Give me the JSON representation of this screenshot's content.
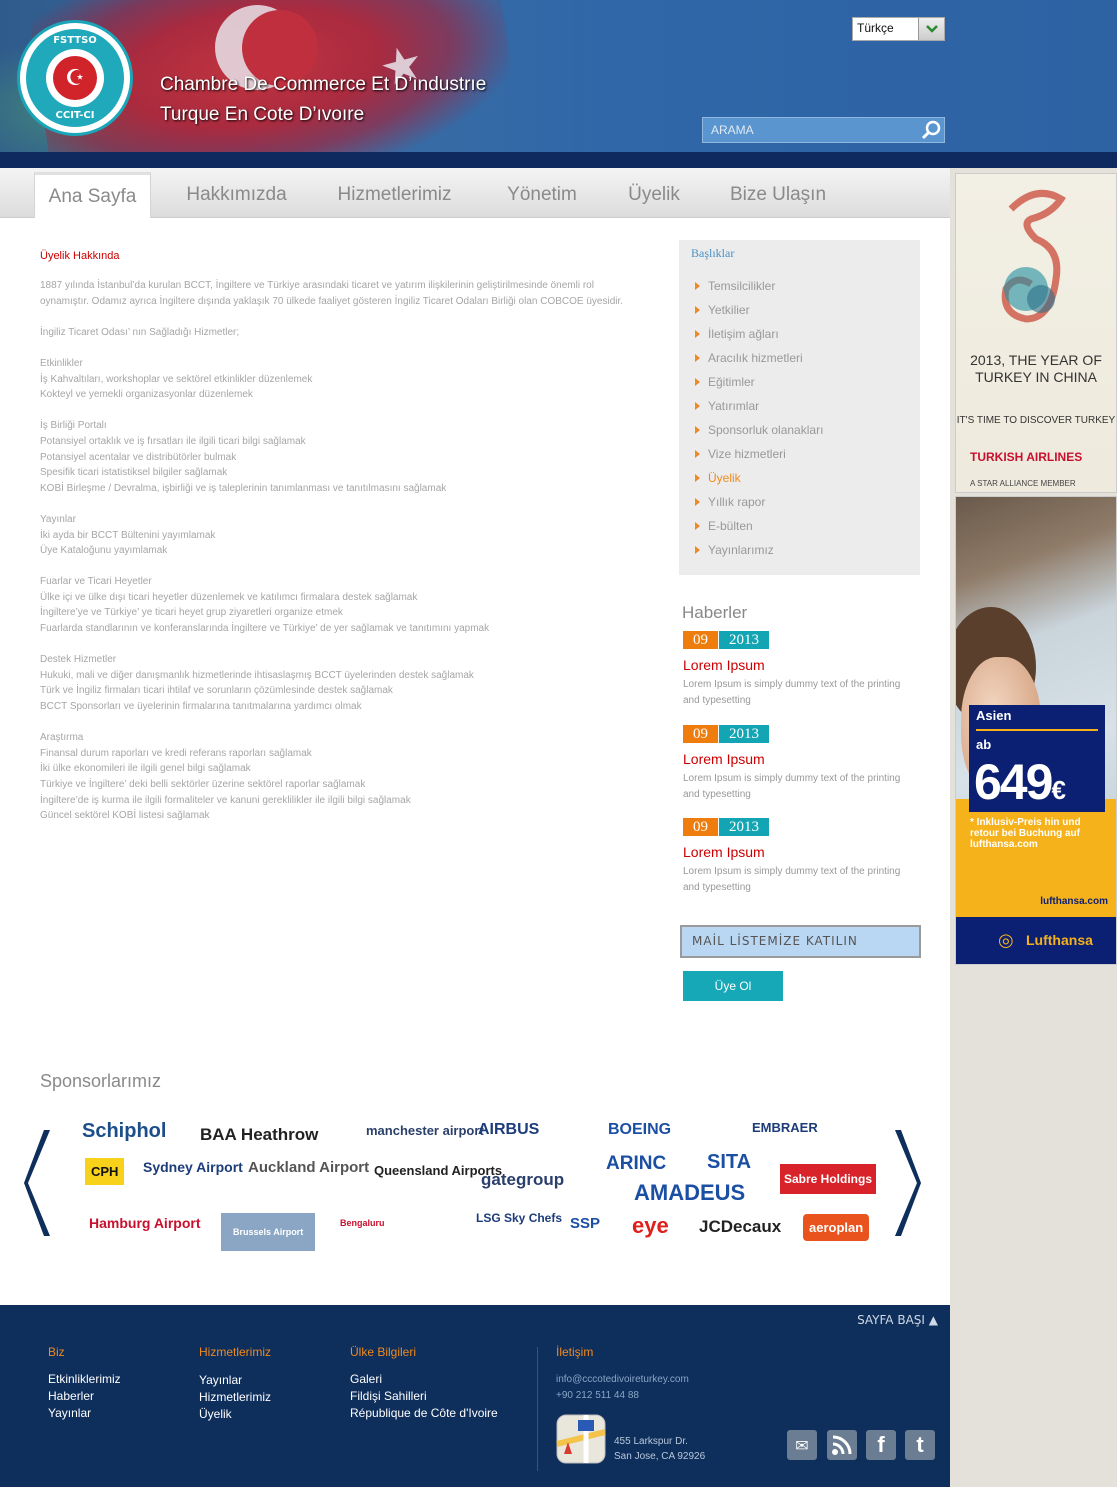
{
  "header": {
    "logo_top": "FSTTSO",
    "logo_bottom": "CCIT-CI",
    "title_line1": "Chambre De Commerce  Et D’ındustrıe",
    "title_line2": "Turque En Cote D’ıvoıre",
    "language": "Türkçe",
    "search_placeholder": "ARAMA"
  },
  "nav": {
    "items": [
      "Ana Sayfa",
      "Hakkımızda",
      "Hizmetlerimiz",
      "Yönetim",
      "Üyelik",
      "Bize Ulaşın"
    ],
    "active": "Ana Sayfa"
  },
  "content": {
    "title": "Üyelik Hakkında",
    "intro": "1887 yılında İstanbul’da kurulan BCCT, İngiltere ve Türkiye arasındaki ticaret ve yatırım ilişkilerinin geliştirilmesinde önemli rol oynamıştır. Odamız ayrıca İngiltere dışında yaklaşık 70 ülkede faaliyet gösteren İngiliz Ticaret Odaları Birliği olan COBCOE üyesidir.",
    "services_heading": "İngiliz Ticaret Odası’ nın Sağladığı Hizmetler;",
    "sections": [
      {
        "title": "Etkinlikler",
        "lines": [
          "İş Kahvaltıları, workshoplar ve sektörel etkinlikler düzenlemek",
          "Kokteyl ve yemekli organizasyonlar düzenlemek"
        ]
      },
      {
        "title": "İş Birliği Portalı",
        "lines": [
          "Potansiyel ortaklık ve iş fırsatları ile ilgili ticari bilgi sağlamak",
          "Potansiyel acentalar ve distribütörler bulmak",
          "Spesifik ticari istatistiksel bilgiler sağlamak",
          "KOBİ Birleşme / Devralma, işbirliği ve iş taleplerinin tanımlanması ve tanıtılmasını sağlamak"
        ]
      },
      {
        "title": "Yayınlar",
        "lines": [
          "İki ayda bir BCCT Bültenini yayımlamak",
          "Üye Kataloğunu yayımlamak"
        ]
      },
      {
        "title": "Fuarlar ve Ticari Heyetler",
        "lines": [
          "Ülke içi ve ülke dışı ticari heyetler düzenlemek ve katılımcı firmalara destek sağlamak",
          "İngiltere’ye ve Türkiye’ ye ticari heyet grup ziyaretleri organize etmek",
          "Fuarlarda standlarının ve konferanslarında İngiltere ve Türkiye’ de yer sağlamak ve tanıtımını yapmak"
        ]
      },
      {
        "title": "Destek Hizmetler",
        "lines": [
          "Hukuki, mali ve diğer danışmanlık hizmetlerinde ihtisaslaşmış BCCT üyelerinden destek sağlamak",
          "Türk ve İngiliz firmaları ticari ihtilaf ve sorunların çözümlesinde destek sağlamak",
          "BCCT Sponsorları ve üyelerinin firmalarına tanıtmalarına yardımcı olmak"
        ]
      },
      {
        "title": "Araştırma",
        "lines": [
          "Finansal durum raporları ve kredi referans raporları sağlamak",
          "İki ülke ekonomileri ile ilgili genel bilgi sağlamak",
          "Türkiye ve İngiltere’ deki belli sektörler üzerine sektörel raporlar sağlamak",
          "İngiltere’de iş kurma ile ilgili formaliteler ve kanuni gereklilikler ile ilgili bilgi sağlamak",
          "Güncel sektörel KOBİ listesi sağlamak"
        ]
      }
    ]
  },
  "sidebar": {
    "heading": "Başlıklar",
    "items": [
      "Temsilcilikler",
      "Yetkilier",
      "İletişim ağları",
      "Aracılık hizmetleri",
      "Eğitimler",
      "Yatırımlar",
      "Sponsorluk olanakları",
      "Vize hizmetleri",
      "Üyelik",
      "Yıllık rapor",
      "E-bülten",
      "Yayınlarımız"
    ],
    "active": "Üyelik"
  },
  "news": {
    "heading": "Haberler",
    "items": [
      {
        "day": "09",
        "year": "2013",
        "title": "Lorem Ipsum",
        "text": "Lorem Ipsum is simply dummy text of the printing and typesetting"
      },
      {
        "day": "09",
        "year": "2013",
        "title": "Lorem Ipsum",
        "text": "Lorem Ipsum is simply dummy text of the printing and typesetting"
      },
      {
        "day": "09",
        "year": "2013",
        "title": "Lorem Ipsum",
        "text": "Lorem Ipsum is simply dummy text of the printing and typesetting"
      }
    ]
  },
  "mailing": {
    "label": "MAİL LİSTEMİZE KATILIN",
    "button": "Üye Ol"
  },
  "sponsors": {
    "heading": "Sponsorlarımız",
    "logos": [
      "Schiphol",
      "BAA Heathrow",
      "manchester airport",
      "AIRBUS",
      "BOEING",
      "EMBRAER",
      "CPH",
      "Sydney Airport",
      "Auckland Airport",
      "Queensland Airports",
      "gategroup",
      "ARINC",
      "SITA",
      "Sabre Holdings",
      "AMADEUS",
      "Hamburg Airport",
      "Brussels Airport",
      "Bengaluru",
      "LSG Sky Chefs",
      "SSP",
      "eye",
      "JCDecaux",
      "aeroplan"
    ]
  },
  "ads": {
    "thy": {
      "line1": "2013, THE YEAR OF TURKEY IN CHINA",
      "line2": "IT'S TIME TO DISCOVER TURKEY",
      "brand": "TURKISH AIRLINES",
      "member": "A STAR ALLIANCE MEMBER"
    },
    "lufthansa": {
      "region": "Asien",
      "ab": "ab",
      "price": "649",
      "currency": "€",
      "note": "* Inklusiv-Preis hin und retour bei Buchung auf lufthansa.com",
      "url": "lufthansa.com",
      "brand": "Lufthansa"
    }
  },
  "footer": {
    "scroll_top": "SAYFA BAŞI",
    "col1": {
      "title": "Biz",
      "items": [
        "Etkinliklerimiz",
        "Haberler",
        "Yayınlar"
      ]
    },
    "col2": {
      "title": "Hizmetlerimiz",
      "items": [
        "Yayınlar",
        "Hizmetlerimiz",
        "Üyelik"
      ]
    },
    "col3": {
      "title": "Ülke Bilgileri",
      "items": [
        "Galeri",
        "Fildişi Sahilleri",
        "République de Côte d'Ivoire"
      ]
    },
    "col4": {
      "title": "İletişim",
      "email": "info@cccotedivoireturkey.com",
      "phone": "+90 212 511 44 88",
      "address1": "455 Larkspur Dr.",
      "address2": "San Jose, CA 92926"
    }
  }
}
